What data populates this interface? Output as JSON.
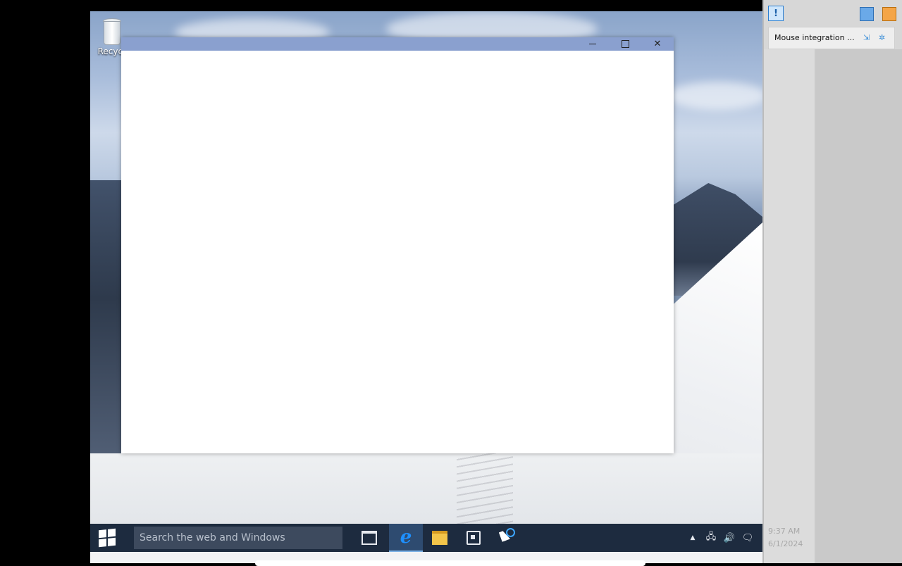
{
  "desktop": {
    "icons": [
      {
        "label": "Recycl"
      }
    ]
  },
  "window": {
    "title": "",
    "controls": {
      "minimize": "—",
      "maximize": "☐",
      "close": "✕"
    }
  },
  "taskbar": {
    "search_placeholder": "Search the web and Windows",
    "pinned": [
      {
        "name": "task-view-icon"
      },
      {
        "name": "internet-explorer-icon",
        "glyph": "e",
        "active": true
      },
      {
        "name": "file-explorer-icon"
      },
      {
        "name": "store-icon"
      }
    ],
    "tray": {
      "show_hidden": "▲",
      "network": "🖧",
      "volume": "🔊",
      "notifications": "🗨"
    }
  },
  "vm_panel": {
    "info_glyph": "!",
    "notification": "Mouse integration ...",
    "clock": "9:37 AM",
    "date": "6/1/2024"
  },
  "colors": {
    "titlebar": "#8aa0cf",
    "taskbar": "#1d2b3f",
    "accent": "#3da6ff"
  }
}
